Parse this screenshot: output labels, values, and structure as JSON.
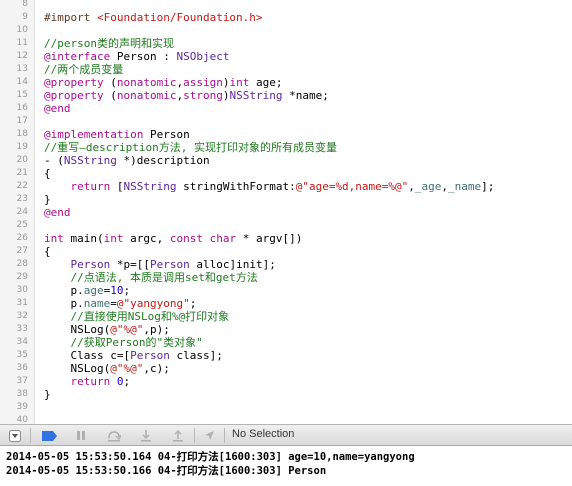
{
  "code_lines": [
    {
      "num": "8",
      "segs": []
    },
    {
      "num": "9",
      "segs": [
        {
          "t": "#import ",
          "c": "preproc"
        },
        {
          "t": "<Foundation/Foundation.h>",
          "c": "string"
        }
      ]
    },
    {
      "num": "10",
      "segs": []
    },
    {
      "num": "11",
      "segs": [
        {
          "t": "//person类的声明和实现",
          "c": "comment"
        }
      ]
    },
    {
      "num": "12",
      "segs": [
        {
          "t": "@interface",
          "c": "keyword"
        },
        {
          "t": " Person : ",
          "c": "plain"
        },
        {
          "t": "NSObject",
          "c": "class"
        }
      ]
    },
    {
      "num": "13",
      "segs": [
        {
          "t": "//两个成员变量",
          "c": "comment"
        }
      ]
    },
    {
      "num": "14",
      "segs": [
        {
          "t": "@property",
          "c": "keyword"
        },
        {
          "t": " (",
          "c": "plain"
        },
        {
          "t": "nonatomic",
          "c": "keyword"
        },
        {
          "t": ",",
          "c": "plain"
        },
        {
          "t": "assign",
          "c": "keyword"
        },
        {
          "t": ")",
          "c": "plain"
        },
        {
          "t": "int",
          "c": "keyword"
        },
        {
          "t": " age;",
          "c": "plain"
        }
      ]
    },
    {
      "num": "15",
      "segs": [
        {
          "t": "@property",
          "c": "keyword"
        },
        {
          "t": " (",
          "c": "plain"
        },
        {
          "t": "nonatomic",
          "c": "keyword"
        },
        {
          "t": ",",
          "c": "plain"
        },
        {
          "t": "strong",
          "c": "keyword"
        },
        {
          "t": ")",
          "c": "plain"
        },
        {
          "t": "NSString",
          "c": "class"
        },
        {
          "t": " *name;",
          "c": "plain"
        }
      ]
    },
    {
      "num": "16",
      "segs": [
        {
          "t": "@end",
          "c": "keyword"
        }
      ]
    },
    {
      "num": "17",
      "segs": []
    },
    {
      "num": "18",
      "segs": [
        {
          "t": "@implementation",
          "c": "keyword"
        },
        {
          "t": " Person",
          "c": "plain"
        }
      ]
    },
    {
      "num": "19",
      "segs": [
        {
          "t": "//重写—description方法, 实现打印对象的所有成员变量",
          "c": "comment"
        }
      ]
    },
    {
      "num": "20",
      "segs": [
        {
          "t": "- (",
          "c": "plain"
        },
        {
          "t": "NSString",
          "c": "class"
        },
        {
          "t": " *)description",
          "c": "plain"
        }
      ]
    },
    {
      "num": "21",
      "segs": [
        {
          "t": "{",
          "c": "plain"
        }
      ]
    },
    {
      "num": "22",
      "segs": [
        {
          "t": "    ",
          "c": "plain"
        },
        {
          "t": "return",
          "c": "keyword"
        },
        {
          "t": " [",
          "c": "plain"
        },
        {
          "t": "NSString",
          "c": "class"
        },
        {
          "t": " stringWithFormat:",
          "c": "plain"
        },
        {
          "t": "@\"age=%d,name=%@\"",
          "c": "string"
        },
        {
          "t": ",",
          "c": "plain"
        },
        {
          "t": "_age",
          "c": "ivar"
        },
        {
          "t": ",",
          "c": "plain"
        },
        {
          "t": "_name",
          "c": "ivar"
        },
        {
          "t": "];",
          "c": "plain"
        }
      ]
    },
    {
      "num": "23",
      "segs": [
        {
          "t": "}",
          "c": "plain"
        }
      ]
    },
    {
      "num": "24",
      "segs": [
        {
          "t": "@end",
          "c": "keyword"
        }
      ]
    },
    {
      "num": "25",
      "segs": []
    },
    {
      "num": "26",
      "segs": [
        {
          "t": "int",
          "c": "keyword"
        },
        {
          "t": " main(",
          "c": "plain"
        },
        {
          "t": "int",
          "c": "keyword"
        },
        {
          "t": " argc, ",
          "c": "plain"
        },
        {
          "t": "const",
          "c": "keyword"
        },
        {
          "t": " ",
          "c": "plain"
        },
        {
          "t": "char",
          "c": "keyword"
        },
        {
          "t": " * argv[])",
          "c": "plain"
        }
      ]
    },
    {
      "num": "27",
      "segs": [
        {
          "t": "{",
          "c": "plain"
        }
      ]
    },
    {
      "num": "28",
      "segs": [
        {
          "t": "    ",
          "c": "plain"
        },
        {
          "t": "Person",
          "c": "class"
        },
        {
          "t": " *p=[[",
          "c": "plain"
        },
        {
          "t": "Person",
          "c": "class"
        },
        {
          "t": " alloc]init];",
          "c": "plain"
        }
      ]
    },
    {
      "num": "29",
      "segs": [
        {
          "t": "    //点语法, 本质是调用set和get方法",
          "c": "comment"
        }
      ]
    },
    {
      "num": "30",
      "segs": [
        {
          "t": "    p.",
          "c": "plain"
        },
        {
          "t": "age",
          "c": "ivar"
        },
        {
          "t": "=",
          "c": "plain"
        },
        {
          "t": "10",
          "c": "number"
        },
        {
          "t": ";",
          "c": "plain"
        }
      ]
    },
    {
      "num": "31",
      "segs": [
        {
          "t": "    p.",
          "c": "plain"
        },
        {
          "t": "name",
          "c": "ivar"
        },
        {
          "t": "=",
          "c": "plain"
        },
        {
          "t": "@\"yangyong\"",
          "c": "string"
        },
        {
          "t": ";",
          "c": "plain"
        }
      ]
    },
    {
      "num": "32",
      "segs": [
        {
          "t": "    //直接使用NSLog和%@打印对象",
          "c": "comment"
        }
      ]
    },
    {
      "num": "33",
      "segs": [
        {
          "t": "    NSLog(",
          "c": "plain"
        },
        {
          "t": "@\"%@\"",
          "c": "string"
        },
        {
          "t": ",p);",
          "c": "plain"
        }
      ]
    },
    {
      "num": "34",
      "segs": [
        {
          "t": "    //获取Person的\"类对象\"",
          "c": "comment"
        }
      ]
    },
    {
      "num": "35",
      "segs": [
        {
          "t": "    Class c=[",
          "c": "plain"
        },
        {
          "t": "Person",
          "c": "class"
        },
        {
          "t": " class];",
          "c": "plain"
        }
      ]
    },
    {
      "num": "36",
      "segs": [
        {
          "t": "    NSLog(",
          "c": "plain"
        },
        {
          "t": "@\"%@\"",
          "c": "string"
        },
        {
          "t": ",c);",
          "c": "plain"
        }
      ]
    },
    {
      "num": "37",
      "segs": [
        {
          "t": "    ",
          "c": "plain"
        },
        {
          "t": "return",
          "c": "keyword"
        },
        {
          "t": " ",
          "c": "plain"
        },
        {
          "t": "0",
          "c": "number"
        },
        {
          "t": ";",
          "c": "plain"
        }
      ]
    },
    {
      "num": "38",
      "segs": [
        {
          "t": "}",
          "c": "plain"
        }
      ]
    },
    {
      "num": "39",
      "segs": []
    },
    {
      "num": "40",
      "segs": []
    }
  ],
  "debug_bar": {
    "buttons": [
      "disclosure-icon",
      "breakpoints-icon",
      "pause-icon",
      "step-over-icon",
      "step-into-icon",
      "step-out-icon",
      "location-icon"
    ],
    "selection_label": "No Selection",
    "accent_color": "#2f72e0"
  },
  "console": {
    "lines": [
      "2014-05-05 15:53:50.164 04-打印方法[1600:303] age=10,name=yangyong",
      "2014-05-05 15:53:50.166 04-打印方法[1600:303] Person"
    ]
  }
}
